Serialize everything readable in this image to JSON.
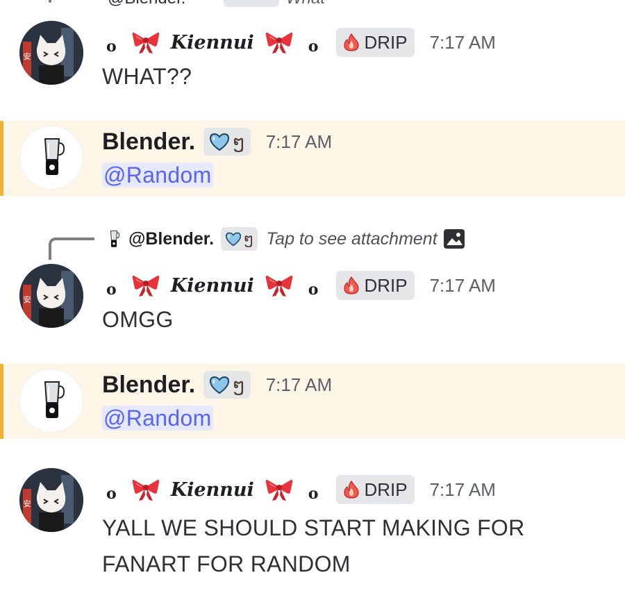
{
  "top_reply": {
    "name": "@Blender.",
    "text": "What"
  },
  "users": {
    "kiennui": {
      "ring": "o",
      "name": "Kiennui",
      "tag": "DRIP"
    },
    "blender": {
      "name": "Blender.",
      "tag_swirl": "ໆ"
    }
  },
  "messages": [
    {
      "author": "kiennui",
      "time": "7:17 AM",
      "text": "WHAT??"
    },
    {
      "author": "blender",
      "time": "7:17 AM",
      "mention": "@Random"
    },
    {
      "author": "kiennui",
      "time": "7:17 AM",
      "text": "OMGG",
      "reply": {
        "name": "@Blender.",
        "swirl": "ໆ",
        "text": "Tap to see attachment"
      }
    },
    {
      "author": "blender",
      "time": "7:17 AM",
      "mention": "@Random"
    },
    {
      "author": "kiennui",
      "time": "7:17 AM",
      "text_line1": "YALL WE SHOULD START MAKING FOR",
      "text_line2": "FANART FOR RANDOM"
    }
  ],
  "colors": {
    "mention_bg": "#fdf6e6",
    "mention_bar": "#f0b232",
    "mention_text": "#5865f2",
    "tag_bg": "#e5e6e8"
  },
  "icons": [
    "blender-icon",
    "heart-icon",
    "flame-icon",
    "bow-icon",
    "image-icon"
  ]
}
